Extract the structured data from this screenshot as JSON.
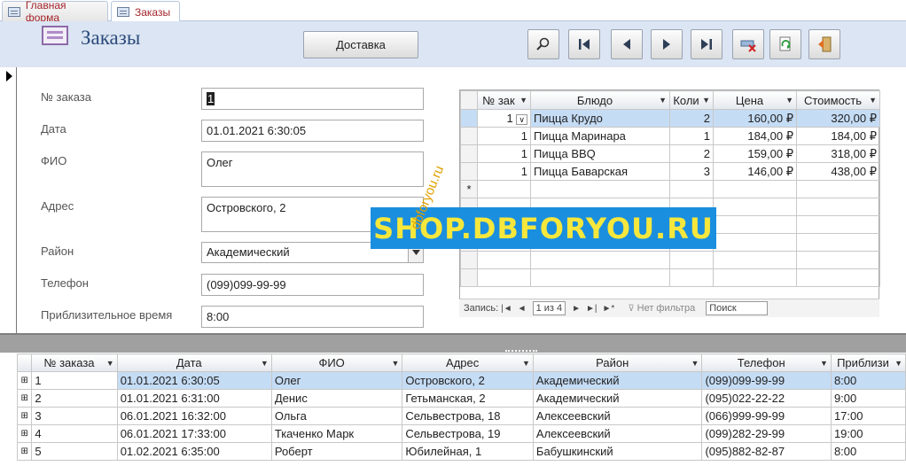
{
  "tabs": [
    {
      "label": "Главная форма",
      "active": false
    },
    {
      "label": "Заказы",
      "active": true
    }
  ],
  "header": {
    "title": "Заказы",
    "delivery_button": "Доставка",
    "nav_icons": [
      "search-icon",
      "first-record-icon",
      "prev-record-icon",
      "next-record-icon",
      "last-record-icon",
      "delete-record-icon",
      "refresh-icon",
      "close-form-icon"
    ]
  },
  "form": {
    "fields": [
      {
        "label": "№ заказа",
        "value": "1"
      },
      {
        "label": "Дата",
        "value": "01.01.2021 6:30:05"
      },
      {
        "label": "ФИО",
        "value": "Олег"
      },
      {
        "label": "Адрес",
        "value": "Островского, 2"
      },
      {
        "label": "Район",
        "value": "Академический"
      },
      {
        "label": "Телефон",
        "value": "(099)099-99-99"
      },
      {
        "label": "Приблизительное время",
        "value": "8:00"
      }
    ]
  },
  "subform": {
    "columns": [
      "№ зак",
      "Блюдо",
      "Коли",
      "Цена",
      "Стоимость"
    ],
    "rows": [
      [
        "1",
        "Пицца Крудо",
        "2",
        "160,00 ₽",
        "320,00 ₽"
      ],
      [
        "1",
        "Пицца Маринара",
        "1",
        "184,00 ₽",
        "184,00 ₽"
      ],
      [
        "1",
        "Пицца BBQ",
        "2",
        "159,00 ₽",
        "318,00 ₽"
      ],
      [
        "1",
        "Пицца Баварская",
        "3",
        "146,00 ₽",
        "438,00 ₽"
      ]
    ],
    "new_row_marker": "*",
    "recnav": {
      "label": "Запись:",
      "position": "1 из 4",
      "filter": "Нет фильтра",
      "search": "Поиск"
    }
  },
  "watermark": {
    "main": "SHOP.DBFORYOU.RU",
    "diagonal": "dbforyou.ru"
  },
  "maingrid": {
    "columns": [
      "№ заказа",
      "Дата",
      "ФИО",
      "Адрес",
      "Район",
      "Телефон",
      "Приблизи"
    ],
    "rows": [
      [
        "1",
        "01.01.2021 6:30:05",
        "Олег",
        "Островского, 2",
        "Академический",
        "(099)099-99-99",
        "8:00"
      ],
      [
        "2",
        "01.01.2021 6:31:00",
        "Денис",
        "Гетьманская, 2",
        "Академический",
        "(095)022-22-22",
        "9:00"
      ],
      [
        "3",
        "06.01.2021 16:32:00",
        "Ольга",
        "Сельвестрова, 18",
        "Алексеевский",
        "(066)999-99-99",
        "17:00"
      ],
      [
        "4",
        "06.01.2021 17:33:00",
        "Ткаченко Марк",
        "Сельвестрова, 19",
        "Алексеевский",
        "(099)282-29-99",
        "19:00"
      ],
      [
        "5",
        "01.02.2021 6:35:00",
        "Роберт",
        "Юбилейная, 1",
        "Бабушкинский",
        "(095)882-82-87",
        "8:00"
      ]
    ]
  }
}
